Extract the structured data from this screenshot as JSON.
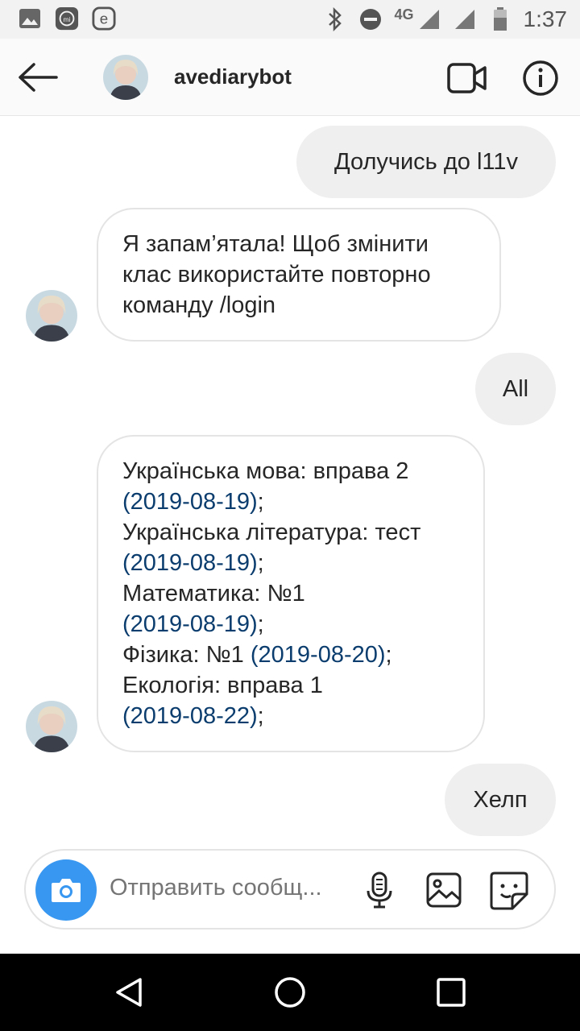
{
  "status_bar": {
    "time": "1:37",
    "network": "4G",
    "left_icons": [
      "image-icon",
      "mi-icon",
      "e-icon"
    ],
    "right_icons": [
      "bluetooth-icon",
      "dnd-icon",
      "signal-icon",
      "signal-icon",
      "battery-icon"
    ]
  },
  "header": {
    "username": "avediarybot"
  },
  "messages": [
    {
      "sender": "me",
      "text": "Долучись до l11v"
    },
    {
      "sender": "bot",
      "lines": [
        "Я запам’ятала! Щоб змінити",
        "клас використайте повторно",
        "команду /login"
      ]
    },
    {
      "sender": "me",
      "text": "All"
    },
    {
      "sender": "bot",
      "items": [
        {
          "prefix": "Українська мова: вправа 2",
          "date": "(2019-08-19)"
        },
        {
          "prefix": "Українська література: тест",
          "date": "(2019-08-19)"
        },
        {
          "prefix": "Математика: №1",
          "date": "(2019-08-19)"
        },
        {
          "prefix": "Фізика: №1",
          "date": "(2019-08-20)"
        },
        {
          "prefix": "Екологія: вправа 1",
          "date": "(2019-08-22)"
        }
      ]
    },
    {
      "sender": "me",
      "text": "Хелп"
    }
  ],
  "composer": {
    "placeholder": "Отправить сообщ..."
  },
  "colors": {
    "accent": "#3897f0",
    "date_link": "#0b3d6e",
    "bubble_out": "#efefef"
  }
}
